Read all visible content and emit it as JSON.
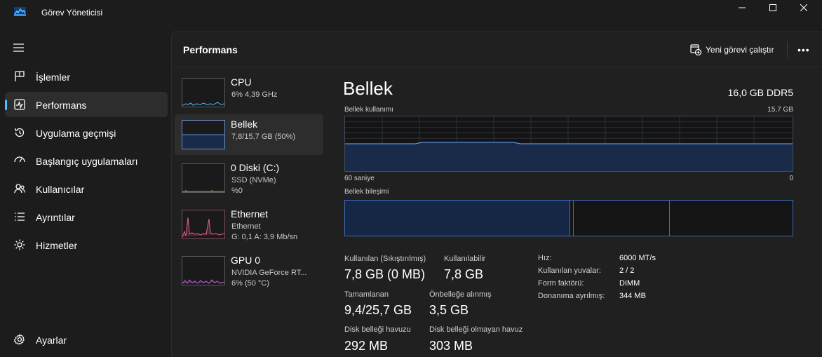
{
  "window": {
    "title": "Görev Yöneticisi"
  },
  "sidebar": {
    "items": [
      {
        "label": "İşlemler",
        "icon": "grid-icon"
      },
      {
        "label": "Performans",
        "icon": "performance-icon",
        "active": true
      },
      {
        "label": "Uygulama geçmişi",
        "icon": "history-icon"
      },
      {
        "label": "Başlangıç uygulamaları",
        "icon": "startup-icon"
      },
      {
        "label": "Kullanıcılar",
        "icon": "users-icon"
      },
      {
        "label": "Ayrıntılar",
        "icon": "details-icon"
      },
      {
        "label": "Hizmetler",
        "icon": "services-icon"
      }
    ],
    "settings_label": "Ayarlar"
  },
  "header": {
    "title": "Performans",
    "run_task_label": "Yeni görevi çalıştır"
  },
  "tiles": [
    {
      "name": "CPU",
      "sub": "6% 4,39 GHz",
      "sub2": ""
    },
    {
      "name": "Bellek",
      "sub": "7,8/15,7 GB (50%)",
      "sub2": ""
    },
    {
      "name": "0 Diski (C:)",
      "sub": "SSD (NVMe)",
      "sub2": "%0"
    },
    {
      "name": "Ethernet",
      "sub": "Ethernet",
      "sub2": "G: 0,1 A: 3,9 Mb/sn"
    },
    {
      "name": "GPU 0",
      "sub": "NVIDIA GeForce RT...",
      "sub2": "6% (50 °C)"
    }
  ],
  "detail": {
    "title": "Bellek",
    "spec": "16,0 GB DDR5",
    "usage_label": "Bellek kullanımı",
    "usage_max": "15,7 GB",
    "time_label": "60 saniye",
    "time_end": "0",
    "usage_level": 0.5,
    "composition_label": "Bellek bileşimi",
    "stats": [
      {
        "label": "Kullanılan (Sıkıştırılmış)",
        "value": "7,8 GB (0 MB)"
      },
      {
        "label": "Kullanılabilir",
        "value": "7,8 GB"
      },
      {
        "label": "Tamamlanan",
        "value": "9,4/25,7 GB"
      },
      {
        "label": "Önbelleğe alınmış",
        "value": "3,5 GB"
      },
      {
        "label": "Disk belleği havuzu",
        "value": "292 MB"
      },
      {
        "label": "Disk belleği olmayan havuz",
        "value": "303 MB"
      }
    ],
    "kv": [
      {
        "k": "Hız:",
        "v": "6000 MT/s"
      },
      {
        "k": "Kullanılan yuvalar:",
        "v": "2 / 2"
      },
      {
        "k": "Form faktörü:",
        "v": "DIMM"
      },
      {
        "k": "Donanıma ayrılmış:",
        "v": "344 MB"
      }
    ]
  },
  "colors": {
    "accent": "#4cc2ff",
    "memory_fill": "#1a2b4a",
    "memory_line": "#5a8fdc"
  }
}
